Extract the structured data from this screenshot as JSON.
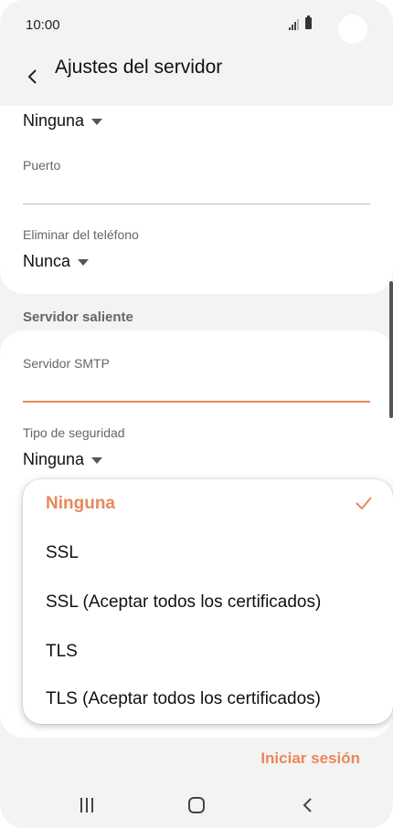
{
  "status_bar": {
    "time": "10:00"
  },
  "header": {
    "title": "Ajustes del servidor"
  },
  "incoming": {
    "security_value": "Ninguna",
    "port_label": "Puerto",
    "port_value": "",
    "delete_label": "Eliminar del teléfono",
    "delete_value": "Nunca"
  },
  "outgoing": {
    "section_title": "Servidor saliente",
    "smtp_label": "Servidor SMTP",
    "smtp_value": "",
    "security_label": "Tipo de seguridad",
    "security_value": "Ninguna"
  },
  "dropdown": {
    "options": [
      {
        "label": "Ninguna",
        "selected": true
      },
      {
        "label": "SSL",
        "selected": false
      },
      {
        "label": "SSL (Aceptar todos los certificados)",
        "selected": false
      },
      {
        "label": "TLS",
        "selected": false
      },
      {
        "label": "TLS (Aceptar todos los certificados)",
        "selected": false
      }
    ]
  },
  "footer": {
    "login_label": "Iniciar sesión"
  },
  "colors": {
    "accent": "#e8885a",
    "background": "#f3f3f3",
    "card": "#ffffff"
  },
  "icons": {
    "back": "back-arrow-icon",
    "check": "checkmark-icon",
    "caret": "dropdown-caret-icon"
  }
}
